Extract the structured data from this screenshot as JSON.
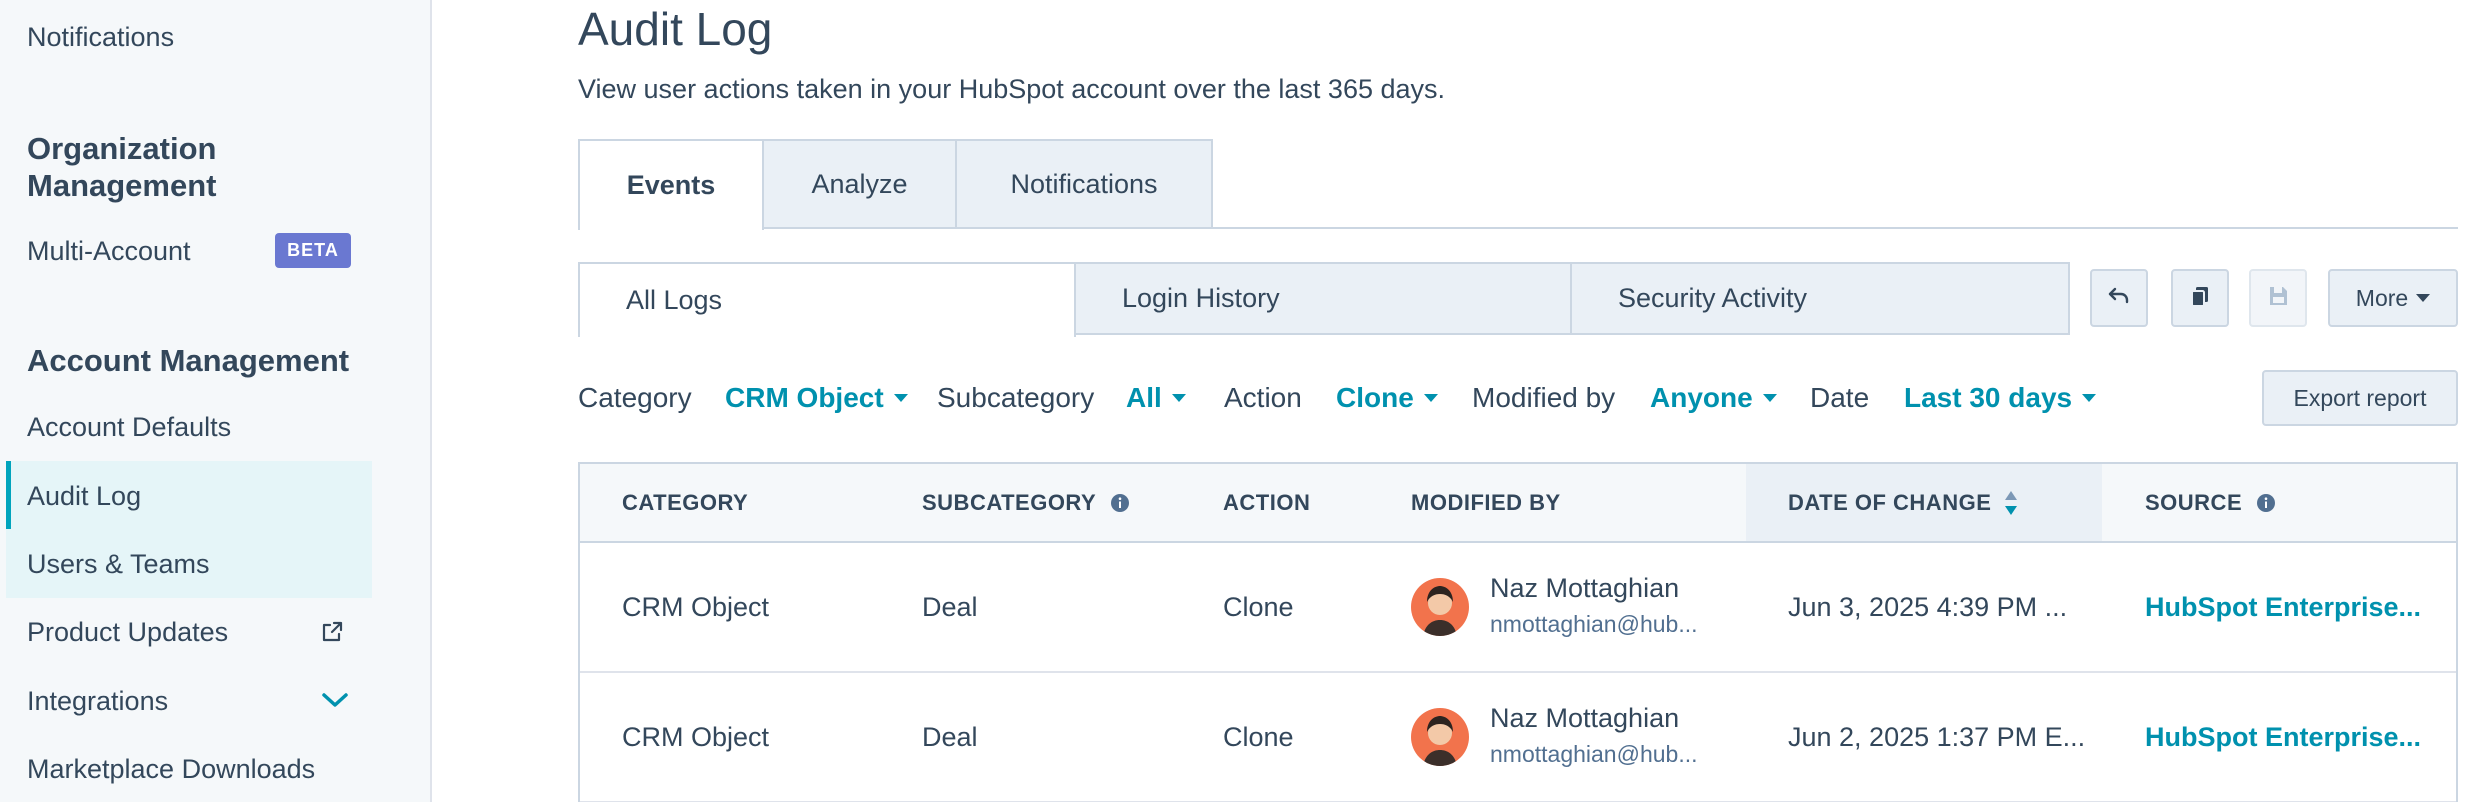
{
  "sidebar": {
    "notifications": "Notifications",
    "org_heading": "Organization Management",
    "multi_account": "Multi-Account",
    "beta_badge": "BETA",
    "account_heading": "Account Management",
    "items": [
      {
        "label": "Account Defaults"
      },
      {
        "label": "Audit Log"
      },
      {
        "label": "Users & Teams"
      },
      {
        "label": "Product Updates",
        "icon": "external-link-icon"
      },
      {
        "label": "Integrations",
        "icon": "chevron-down-icon"
      },
      {
        "label": "Marketplace Downloads"
      }
    ]
  },
  "main": {
    "title": "Audit Log",
    "description": "View user actions taken in your HubSpot account over the last 365 days.",
    "tabs": [
      {
        "label": "Events",
        "active": true
      },
      {
        "label": "Analyze",
        "active": false
      },
      {
        "label": "Notifications",
        "active": false
      }
    ],
    "subtabs": [
      {
        "label": "All Logs",
        "active": true
      },
      {
        "label": "Login History",
        "active": false
      },
      {
        "label": "Security Activity",
        "active": false
      }
    ],
    "toolbar": {
      "undo_icon": "undo-icon",
      "clone_icon": "clone-icon",
      "save_icon": "save-icon",
      "more_label": "More"
    },
    "filters": {
      "category_label": "Category",
      "category_value": "CRM Object",
      "subcategory_label": "Subcategory",
      "subcategory_value": "All",
      "action_label": "Action",
      "action_value": "Clone",
      "modified_by_label": "Modified by",
      "modified_by_value": "Anyone",
      "date_label": "Date",
      "date_value": "Last 30 days",
      "export_label": "Export report"
    },
    "table": {
      "columns": [
        "CATEGORY",
        "SUBCATEGORY",
        "ACTION",
        "MODIFIED BY",
        "DATE OF CHANGE",
        "SOURCE"
      ],
      "rows": [
        {
          "category": "CRM Object",
          "subcategory": "Deal",
          "action": "Clone",
          "user_name": "Naz Mottaghian",
          "user_email": "nmottaghian@hub...",
          "date": "Jun 3, 2025 4:39 PM ...",
          "source": "HubSpot Enterprise..."
        },
        {
          "category": "CRM Object",
          "subcategory": "Deal",
          "action": "Clone",
          "user_name": "Naz Mottaghian",
          "user_email": "nmottaghian@hub...",
          "date": "Jun 2, 2025 1:37 PM E...",
          "source": "HubSpot Enterprise..."
        }
      ]
    },
    "colors": {
      "accent": "#0091ae",
      "active_bar": "#00a4bd",
      "beta": "#6a78d1",
      "avatar": "#f2734c"
    }
  }
}
